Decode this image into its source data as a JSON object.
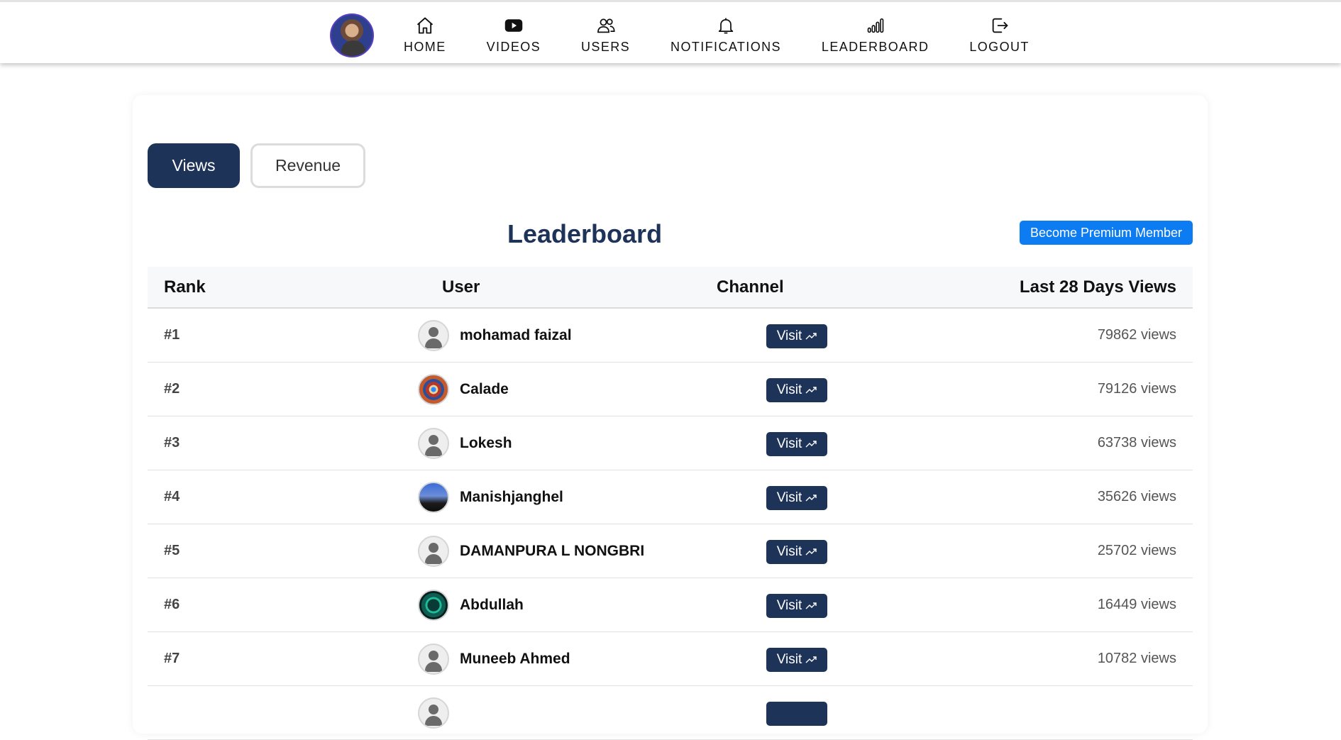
{
  "nav": {
    "items": [
      {
        "label": "HOME",
        "icon": "home-icon"
      },
      {
        "label": "VIDEOS",
        "icon": "video-play-icon"
      },
      {
        "label": "USERS",
        "icon": "users-icon"
      },
      {
        "label": "NOTIFICATIONS",
        "icon": "bell-icon"
      },
      {
        "label": "LEADERBOARD",
        "icon": "signal-bars-icon"
      },
      {
        "label": "LOGOUT",
        "icon": "logout-icon"
      }
    ]
  },
  "tabs": {
    "views": "Views",
    "revenue": "Revenue",
    "active": "Views"
  },
  "title": "Leaderboard",
  "premium_button": "Become Premium Member",
  "table": {
    "headers": {
      "rank": "Rank",
      "user": "User",
      "channel": "Channel",
      "views": "Last 28 Days Views"
    },
    "rows": [
      {
        "rank": "#1",
        "user": "mohamad faizal",
        "visit": "Visit",
        "views": "79862 views"
      },
      {
        "rank": "#2",
        "user": "Calade",
        "visit": "Visit",
        "views": "79126 views"
      },
      {
        "rank": "#3",
        "user": "Lokesh",
        "visit": "Visit",
        "views": "63738 views"
      },
      {
        "rank": "#4",
        "user": "Manishjanghel",
        "visit": "Visit",
        "views": "35626 views"
      },
      {
        "rank": "#5",
        "user": "DAMANPURA L NONGBRI",
        "visit": "Visit",
        "views": "25702 views"
      },
      {
        "rank": "#6",
        "user": "Abdullah",
        "visit": "Visit",
        "views": "16449 views"
      },
      {
        "rank": "#7",
        "user": "Muneeb Ahmed",
        "visit": "Visit",
        "views": "10782 views"
      }
    ]
  },
  "colors": {
    "primary": "#1e3358",
    "premium": "#0d7cf2"
  }
}
